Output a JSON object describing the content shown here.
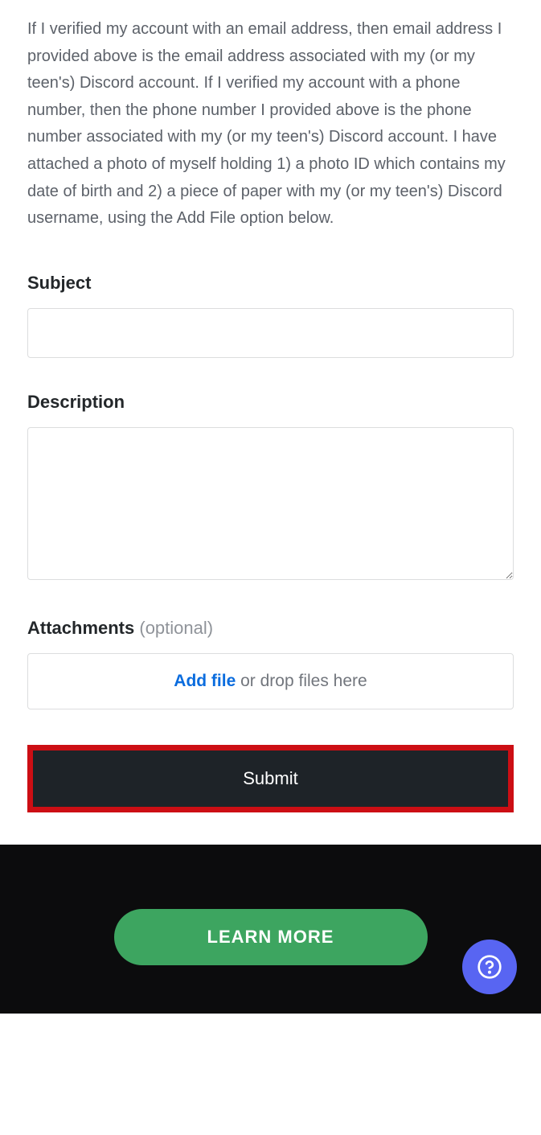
{
  "info_paragraph": "If I verified my account with an email address, then email address I provided above is the email address associated with my (or my teen's) Discord account. If I verified my account with a phone number, then the phone number I provided above is the phone number associated with my (or my teen's) Discord account. I have attached a photo of myself holding 1) a photo ID which contains my date of birth and 2) a piece of paper with my (or my teen's) Discord username, using the Add File option below.",
  "form": {
    "subject": {
      "label": "Subject",
      "value": ""
    },
    "description": {
      "label": "Description",
      "value": ""
    },
    "attachments": {
      "label": "Attachments",
      "optional_text": "(optional)",
      "add_file_text": "Add file",
      "drop_text": " or drop files here"
    },
    "submit_label": "Submit"
  },
  "footer": {
    "learn_more_label": "LEARN MORE"
  }
}
